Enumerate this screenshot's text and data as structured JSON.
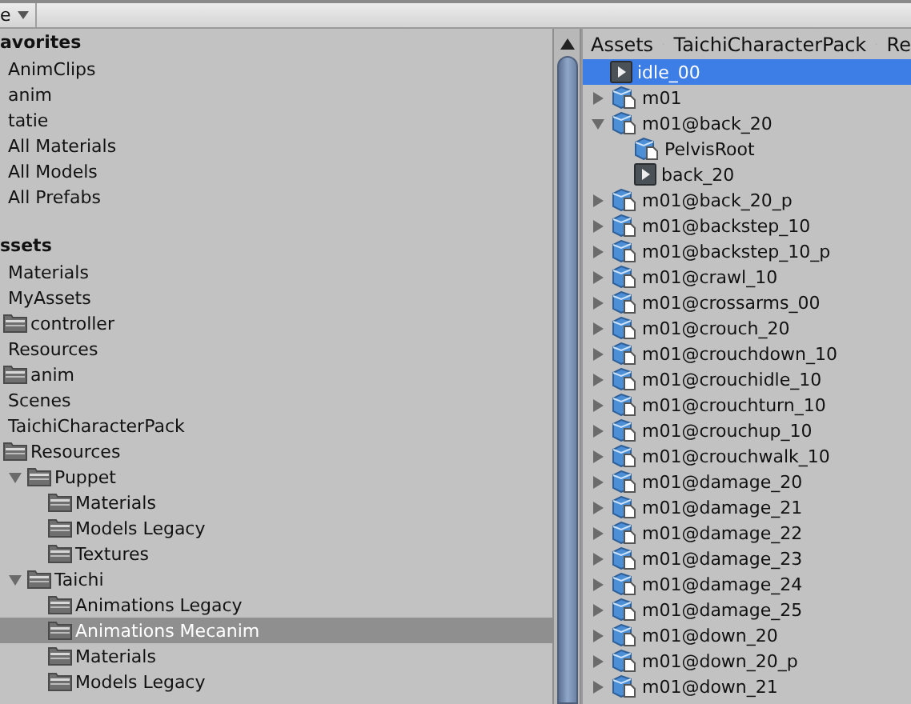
{
  "toolbar": {
    "dropdown": "e"
  },
  "left_panel": {
    "sections": [
      {
        "title": "avorites",
        "items": [
          {
            "label": "AnimClips",
            "selected": false
          },
          {
            "label": "anim",
            "selected": false
          },
          {
            "label": "tatie",
            "selected": false
          },
          {
            "label": "All Materials",
            "selected": false
          },
          {
            "label": "All Models",
            "selected": false
          },
          {
            "label": "All Prefabs",
            "selected": false
          }
        ]
      },
      {
        "title": "ssets",
        "items": [
          {
            "label": "Materials",
            "selected": false
          },
          {
            "label": "MyAssets",
            "selected": false,
            "children": [
              {
                "label": "controller",
                "selected": false
              }
            ]
          },
          {
            "label": "Resources",
            "selected": false,
            "children": [
              {
                "label": "anim",
                "selected": false
              }
            ]
          },
          {
            "label": "Scenes",
            "selected": false
          },
          {
            "label": "TaichiCharacterPack",
            "selected": false,
            "children": [
              {
                "label": "Resources",
                "selected": false,
                "children": [
                  {
                    "label": "Puppet",
                    "selected": false,
                    "expanded": true,
                    "children": [
                      {
                        "label": "Materials",
                        "selected": false
                      },
                      {
                        "label": "Models Legacy",
                        "selected": false
                      },
                      {
                        "label": "Textures",
                        "selected": false
                      }
                    ]
                  },
                  {
                    "label": "Taichi",
                    "selected": false,
                    "expanded": true,
                    "children": [
                      {
                        "label": "Animations Legacy",
                        "selected": false
                      },
                      {
                        "label": "Animations Mecanim",
                        "selected": true
                      },
                      {
                        "label": "Materials",
                        "selected": false
                      },
                      {
                        "label": "Models Legacy",
                        "selected": false
                      }
                    ]
                  }
                ]
              }
            ]
          }
        ]
      }
    ]
  },
  "right_panel": {
    "breadcrumb": [
      "Assets",
      "TaichiCharacterPack",
      "Re"
    ],
    "rows": [
      {
        "label": "idle_00",
        "kind": "clip",
        "selected": true
      },
      {
        "label": "m01",
        "kind": "model",
        "selected": false,
        "expanded": false
      },
      {
        "label": "m01@back_20",
        "kind": "model",
        "selected": false,
        "expanded": true,
        "children": [
          {
            "label": "PelvisRoot",
            "kind": "model",
            "selected": false
          },
          {
            "label": "back_20",
            "kind": "clip",
            "selected": false
          }
        ]
      },
      {
        "label": "m01@back_20_p",
        "kind": "model",
        "selected": false,
        "expanded": false
      },
      {
        "label": "m01@backstep_10",
        "kind": "model",
        "selected": false,
        "expanded": false
      },
      {
        "label": "m01@backstep_10_p",
        "kind": "model",
        "selected": false,
        "expanded": false
      },
      {
        "label": "m01@crawl_10",
        "kind": "model",
        "selected": false,
        "expanded": false
      },
      {
        "label": "m01@crossarms_00",
        "kind": "model",
        "selected": false,
        "expanded": false
      },
      {
        "label": "m01@crouch_20",
        "kind": "model",
        "selected": false,
        "expanded": false
      },
      {
        "label": "m01@crouchdown_10",
        "kind": "model",
        "selected": false,
        "expanded": false
      },
      {
        "label": "m01@crouchidle_10",
        "kind": "model",
        "selected": false,
        "expanded": false
      },
      {
        "label": "m01@crouchturn_10",
        "kind": "model",
        "selected": false,
        "expanded": false
      },
      {
        "label": "m01@crouchup_10",
        "kind": "model",
        "selected": false,
        "expanded": false
      },
      {
        "label": "m01@crouchwalk_10",
        "kind": "model",
        "selected": false,
        "expanded": false
      },
      {
        "label": "m01@damage_20",
        "kind": "model",
        "selected": false,
        "expanded": false
      },
      {
        "label": "m01@damage_21",
        "kind": "model",
        "selected": false,
        "expanded": false
      },
      {
        "label": "m01@damage_22",
        "kind": "model",
        "selected": false,
        "expanded": false
      },
      {
        "label": "m01@damage_23",
        "kind": "model",
        "selected": false,
        "expanded": false
      },
      {
        "label": "m01@damage_24",
        "kind": "model",
        "selected": false,
        "expanded": false
      },
      {
        "label": "m01@damage_25",
        "kind": "model",
        "selected": false,
        "expanded": false
      },
      {
        "label": "m01@down_20",
        "kind": "model",
        "selected": false,
        "expanded": false
      },
      {
        "label": "m01@down_20_p",
        "kind": "model",
        "selected": false,
        "expanded": false
      },
      {
        "label": "m01@down_21",
        "kind": "model",
        "selected": false,
        "expanded": false
      }
    ]
  }
}
